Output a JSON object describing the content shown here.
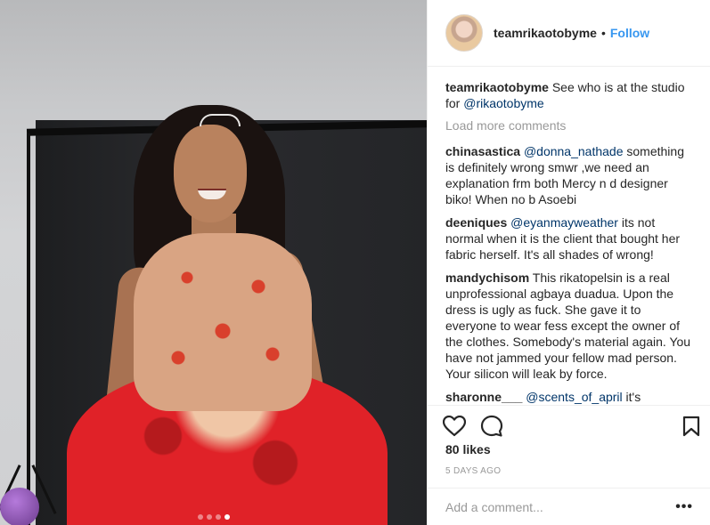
{
  "post": {
    "username": "teamrikaotobyme",
    "separator": "•",
    "follow_label": "Follow",
    "caption": {
      "username": "teamrikaotobyme",
      "text": "See who is at the studio for ",
      "mention": "@rikaotobyme"
    },
    "load_more_label": "Load more comments",
    "comments": [
      {
        "username": "chinasastica",
        "mention": "@donna_nathade",
        "text": " something is definitely wrong smwr ,we need an explanation frm both Mercy n d designer biko! When no b Asoebi"
      },
      {
        "username": "deeniques",
        "mention": "@eyanmayweather",
        "text": " its not normal when it is the client that bought her fabric herself. It's all shades of wrong!"
      },
      {
        "username": "mandychisom",
        "mention": "",
        "text": "This rikatopelsin is a real unprofessional agbaya duadua. Upon the dress is ugly as fuck. She gave it to everyone to wear fess except the owner of the clothes. Somebody's material again. You have not jammed your fellow mad person. Your silicon will leak by force."
      },
      {
        "username": "sharonne___",
        "mention": "@scents_of_april",
        "text": " it's obviously not her size"
      }
    ],
    "likes": "80 likes",
    "date": "5 DAYS AGO",
    "add_comment_placeholder": "Add a comment...",
    "more_label": "•••",
    "carousel": {
      "count": 4,
      "active": 3
    }
  },
  "icons": {
    "heart": "heart-icon",
    "comment": "comment-icon",
    "bookmark": "bookmark-icon"
  },
  "colors": {
    "link": "#3897f0",
    "mention": "#003569",
    "muted": "#999999",
    "text": "#262626"
  }
}
